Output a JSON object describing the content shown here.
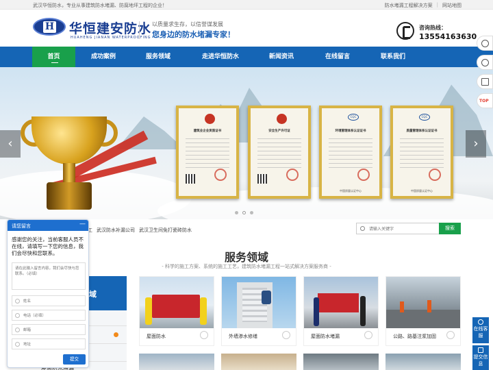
{
  "topbar": {
    "welcome": "武汉华恒防水，专业从事建筑防水堵漏、防腐地坪工程的企业！",
    "links": [
      "防水堵漏工程解决方案",
      "网站地图"
    ]
  },
  "header": {
    "logo_cn": "华恒建安防水",
    "logo_en": "HUAHENG JIANAN WATERPROOFING",
    "slogan_small": "以质量求生存，以信誉谋发展",
    "slogan_big": "您身边的防水堵漏专家！",
    "hotline_label": "咨询热线：",
    "hotline_number": "13554163630"
  },
  "nav": {
    "items": [
      "首页",
      "成功案例",
      "服务领域",
      "走进华恒防水",
      "新闻资讯",
      "在线留言",
      "联系我们"
    ],
    "active": 0,
    "active_color": "#19a04b",
    "bar_color": "#1565b5"
  },
  "banner": {
    "certificates": [
      {
        "title": "建筑业企业资质证书",
        "footer": ""
      },
      {
        "title": "安全生产许可证",
        "footer": ""
      },
      {
        "title": "环境管理体系认证证书",
        "footer": "中国质量认证中心"
      },
      {
        "title": "质量管理体系认证证书",
        "footer": "中国质量认证中心"
      }
    ],
    "arrow_left": "‹",
    "arrow_right": "›",
    "active_slide": 1
  },
  "search": {
    "hot_links": [
      "工",
      "武汉防水补漏公司",
      "武汉卫生间免打瓷砖防水"
    ],
    "placeholder": "请输入关键字",
    "button": "搜索"
  },
  "services": {
    "title": "服务领域",
    "subtitle": "- 科学的施工方案、系统的施工工艺，建筑防水堵漏工程一站式解决方案服务商 -",
    "category_head": "域",
    "category_bottom": "屋面防水堵漏",
    "cards": [
      {
        "caption": "屋面防水"
      },
      {
        "caption": "外墙渗水修缮"
      },
      {
        "caption": "屋面防水堵漏"
      },
      {
        "caption": "公路、路基注浆加固"
      }
    ]
  },
  "side_tabs": [
    {
      "label": "在线客服"
    },
    {
      "label": "提交信息"
    }
  ],
  "float_top": "TOP",
  "chat": {
    "title": "请您留言",
    "minimize": "—",
    "message": "感谢您的关注，当前客服人员不在线，请填写一下您的信息，我们会尽快和您联系。",
    "textarea_placeholder": "请在此输入留言内容，我们会尽快与您联系。（必填）",
    "fields": [
      {
        "placeholder": "姓名"
      },
      {
        "placeholder": "电话（必填）"
      },
      {
        "placeholder": "邮箱"
      },
      {
        "placeholder": "地址"
      }
    ],
    "submit": "提交"
  }
}
